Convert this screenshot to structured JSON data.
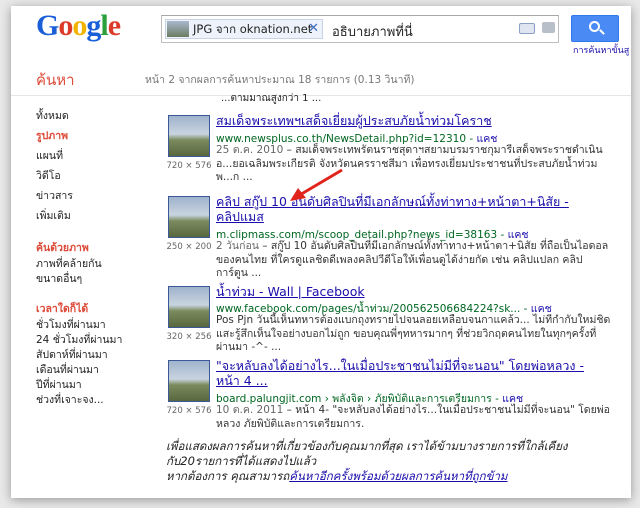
{
  "header": {
    "logo": "Google",
    "chip_label": "JPG จาก oknation.net",
    "query": "อธิบายภาพที่นี่",
    "adv_link": "การค้นหาขั้นสู"
  },
  "sub": {
    "section_title": "ค้นหา",
    "stats": "หน้า 2 จากผลการค้นหาประมาณ 18 รายการ (0.13 วินาที)"
  },
  "nav": {
    "items": [
      "ทั้งหมด",
      "รูปภาพ",
      "แผนที่",
      "วิดีโอ",
      "ข่าวสาร",
      "เพิ่มเติม"
    ],
    "tools_head": "ค้นด้วยภาพ",
    "tools": [
      "ภาพที่คล้ายกัน",
      "ขนาดอื่นๆ"
    ],
    "time_head": "เวลาใดก็ได้",
    "time": [
      "ชั่วโมงที่ผ่านมา",
      "24 ชั่วโมงที่ผ่านมา",
      "สัปดาห์ที่ผ่านมา",
      "เดือนที่ผ่านมา",
      "ปีที่ผ่านมา",
      "ช่วงที่เจาะจง..."
    ]
  },
  "cutoff_text": "...ตามมาณสูงกว่า 1 ...",
  "results": [
    {
      "title": "สมเด็จพระเทพฯเสด็จเยี่ยมผู้ประสบภัยน้ำท่วมโคราช",
      "url": "www.newsplus.co.th/NewsDetail.php?id=12310",
      "cache": "แคช",
      "dim": "720 × 576",
      "date": "25 ต.ค. 2010",
      "snippet": " – สมเด็จพระเทพรัตนราชสุดาฯสยามบรมราชกุมารีเสด็จพระราชดำเนิน อ...ยอเฉลิมพระเกียรติ จังหวัดนครราชสีมา เพื่อทรงเยี่ยมประชาชนที่ประสบภัยน้ำท่วมพ...ก ..."
    },
    {
      "title": "คลิป สกู๊ป 10 อันดับศิลปินที่มีเอกลักษณ์ทั้งท่าทาง+หน้าตา+นิสัย - คลิปแมส",
      "url": "m.clipmass.com/m/scoop_detail.php?news_id=38163",
      "cache": "แคช",
      "dim": "250 × 200",
      "date": "2 วันก่อน",
      "snippet": " – สกู๊ป 10 อันดับศิลปินที่มีเอกลักษณ์ทั้งท่าทาง+หน้าตา+นิสัย ที่ถือเป็นไอดอลของคนไทย ที่ใครดูแลชิดดีเพลงคลิปวีดีโอให้เพื่อนดูได้ง่ายกัด เช่น คลิปแปลก คลิปการ์ตูน ..."
    },
    {
      "title": "น้ำท่วม - Wall | Facebook",
      "url": "www.facebook.com/pages/น้ำท่วม/200562506684224?sk...",
      "cache": "แคช",
      "dim": "320 × 256",
      "date": "",
      "snippet": "Pos Pjn วันนี้เห็นทหารต้องแบกถุงทรายไปจนลอยเหลือบจนกาแคล้ว... ไม่ทีกำกับใหม่ชิดแสะรู้สึกเห็นใจอย่างบอกไม่ถูก ขอบคุณพี่ๆทหารมากๆ ที่ช่วยวิกฤตคนไทยในทุกๆครั้งที่ผ่านมา -^- ..."
    },
    {
      "title": "\"จะหลับลงได้อย่างไร...ในเมื่อประชาชนไม่มีที่จะนอน\" โดยพ่อหลวง - หน้า 4 ...",
      "url": "board.palungjit.com › พลังจิต › ภัยพิบัติและการเตรียมการ",
      "cache": "แคช",
      "dim": "720 × 576",
      "date": "10 ต.ค. 2011",
      "snippet": " – หน้า 4- \"จะหลับลงได้อย่างไร...ในเมื่อประชาชนไม่มีที่จะนอน\" โดยพ่อหลวง ภัยพิบัติและการเตรียมการ."
    }
  ],
  "notice": {
    "line1": "เพื่อแสดงผลการค้นหาที่เกี่ยวข้องกับคุณมากที่สุด เราได้ข้ามบางรายการที่ใกล้เคียงกับ20รายการที่ได้แสดงไปแล้ว",
    "line2_prefix": "หากต้องการ คุณสามารถ",
    "line2_link": "ค้นหาอีกครั้งพร้อมด้วยผลการค้นหาที่ถูกข้าม"
  },
  "colors": {
    "google_blue": "#1a5fd8",
    "google_red": "#dd3b2a",
    "google_yellow": "#f0b400",
    "google_green": "#2a9f3c",
    "link": "#1a0dab",
    "url_green": "#006621",
    "accent_red": "#dd4b39"
  }
}
